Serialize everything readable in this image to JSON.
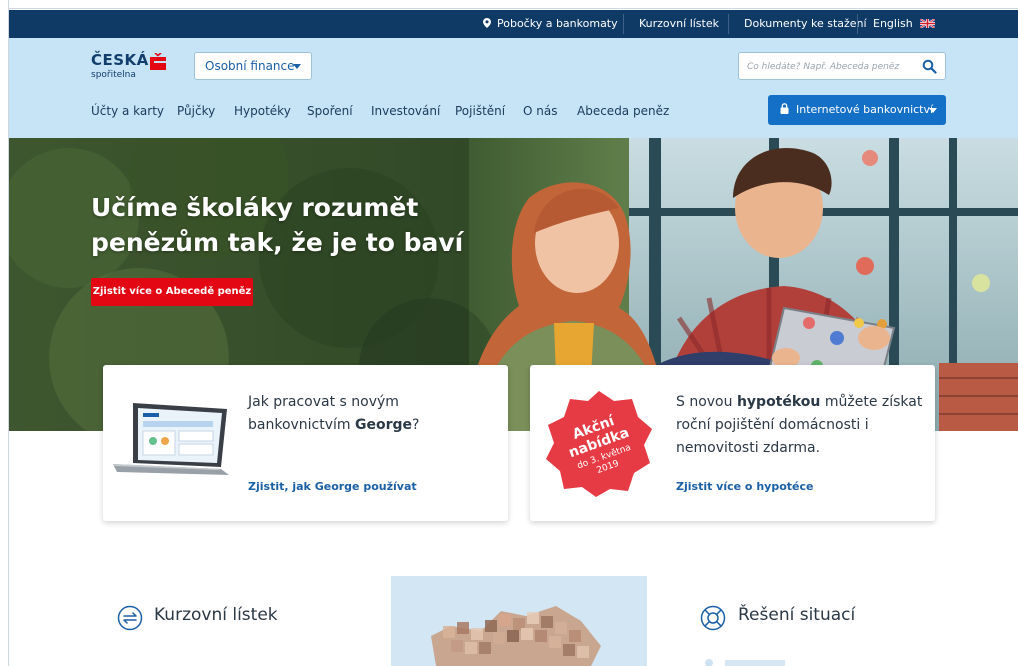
{
  "utility_bar": {
    "branches": "Pobočky a bankomaty",
    "exchange": "Kurzovní lístek",
    "documents": "Dokumenty ke stažení",
    "language": "English"
  },
  "header": {
    "logo_line1": "ČESKÁ",
    "logo_line2": "spořitelna",
    "segment": "Osobní finance",
    "search_placeholder": "Co hledáte? Např. Abeceda peněz",
    "nav": [
      "Účty a karty",
      "Půjčky",
      "Hypotéky",
      "Spoření",
      "Investování",
      "Pojištění",
      "O nás",
      "Abeceda peněz"
    ],
    "internet_banking": "Internetové bankovnictví"
  },
  "hero": {
    "title": "Učíme školáky rozumět penězům tak, že je to baví",
    "cta": "Zjistit více o Abecedě peněz"
  },
  "cards": {
    "george": {
      "text_before": "Jak pracovat s novým bankovnictvím ",
      "text_bold": "George",
      "text_after": "?",
      "link": "Zjistit, jak George používat"
    },
    "mortgage": {
      "badge_line1": "Akční",
      "badge_line2": "nabídka",
      "badge_line3": "do 3. května",
      "badge_line4": "2019",
      "text_before": "S novou ",
      "text_bold": "hypotékou",
      "text_after": " můžete získat roční pojištění domácnosti i nemovitosti zdarma.",
      "link": "Zjistit více o hypotéce"
    }
  },
  "bottom": {
    "exchange_title": "Kurzovní lístek",
    "situations_title": "Řešení situací"
  },
  "colors": {
    "navy": "#0f3a66",
    "header_bg": "#c6e4f5",
    "accent_blue": "#146fc7",
    "red": "#e30613"
  },
  "icons": [
    "map-pin-icon",
    "uk-flag-icon",
    "search-icon",
    "lock-icon",
    "exchange-icon",
    "lifebuoy-icon",
    "sporitelna-s-icon"
  ]
}
